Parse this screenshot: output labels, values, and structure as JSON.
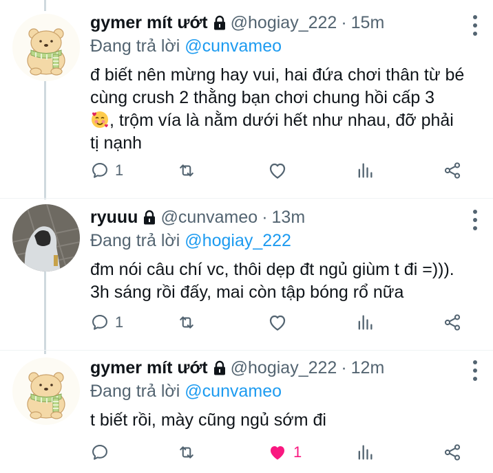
{
  "tweets": [
    {
      "name": "gymer mít ướt",
      "handle": "@hogiay_222",
      "time": "15m",
      "reply_prefix": "Đang trả lời",
      "reply_to": "@cunvameo",
      "text_lines": [
        "đ biết nên mừng hay vui, hai đứa chơi thân từ bé",
        "cùng crush 2 thằng bạn chơi chung hồi cấp 3",
        ", trộm vía là nằm dưới hết như nhau, đỡ phải",
        "tị nạnh"
      ],
      "reply_count": "1",
      "like_count": "",
      "liked": false,
      "avatar_caption": "gmenii"
    },
    {
      "name": "ryuuu",
      "handle": "@cunvameo",
      "time": "13m",
      "reply_prefix": "Đang trả lời",
      "reply_to": "@hogiay_222",
      "text_lines": [
        "đm nói câu chí vc, thôi dẹp đt ngủ giùm t đi =))).",
        "3h sáng rồi đấy, mai còn tập bóng rổ nữa"
      ],
      "reply_count": "1",
      "like_count": "",
      "liked": false
    },
    {
      "name": "gymer mít ướt",
      "handle": "@hogiay_222",
      "time": "12m",
      "reply_prefix": "Đang trả lời",
      "reply_to": "@cunvameo",
      "text_lines": [
        "t biết rồi, mày cũng ngủ sớm đi"
      ],
      "reply_count": "",
      "like_count": "1",
      "liked": true,
      "avatar_caption": "gmenii"
    }
  ],
  "icons": {
    "reply": "reply-icon",
    "retweet": "retweet-icon",
    "like": "heart-icon",
    "views": "analytics-icon",
    "share": "share-icon",
    "lock": "lock-icon",
    "more": "more-icon",
    "emoji": "smiling-face-with-hearts-emoji"
  },
  "colors": {
    "text": "#0f1419",
    "muted": "#536471",
    "link": "#1d9bf0",
    "like": "#f91880",
    "thread_line": "#cfd9de"
  }
}
